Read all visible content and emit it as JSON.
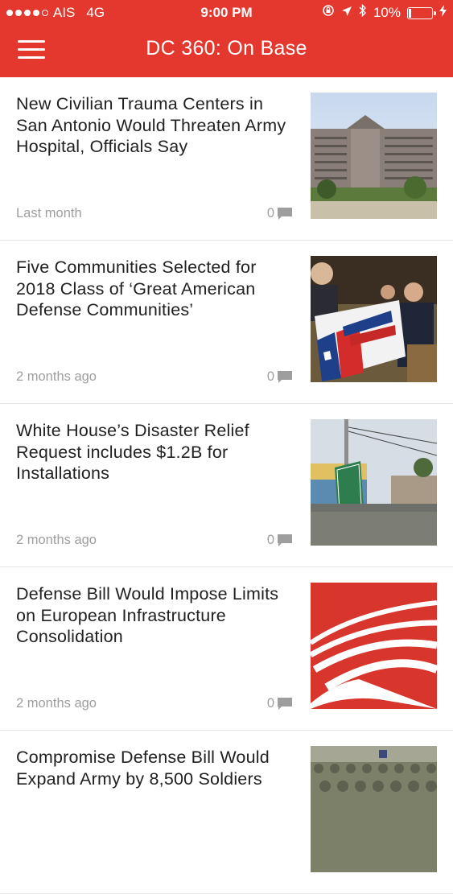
{
  "status_bar": {
    "carrier": "AIS",
    "network": "4G",
    "time": "9:00 PM",
    "battery": "10%",
    "battery_level": 0.1
  },
  "nav": {
    "title": "DC 360: On Base",
    "menu_icon": "hamburger-menu-icon"
  },
  "articles": [
    {
      "title": "New Civilian Trauma Centers in San Antonio Would Threaten Army Hospital, Officials Say",
      "time": "Last month",
      "comments": "0",
      "thumbnail": "hospital-building-image"
    },
    {
      "title": "Five Communities Selected for 2018 Class of ‘Great American Defense Communities’",
      "time": "2 months ago",
      "comments": "0",
      "thumbnail": "great-american-banner-image"
    },
    {
      "title": "White House’s Disaster Relief Request includes $1.2B for Installations",
      "time": "2 months ago",
      "comments": "0",
      "thumbnail": "flooded-street-image"
    },
    {
      "title": "Defense Bill Would Impose Limits on European Infrastructure Consolidation",
      "time": "2 months ago",
      "comments": "0",
      "thumbnail": "red-logo-image"
    },
    {
      "title": "Compromise Defense Bill Would Expand Army by 8,500 Soldiers",
      "time": "",
      "comments": "",
      "thumbnail": "soldiers-formation-image"
    }
  ],
  "colors": {
    "header": "#e4382e",
    "title_text": "#212121",
    "meta_text": "#9e9e9e"
  }
}
